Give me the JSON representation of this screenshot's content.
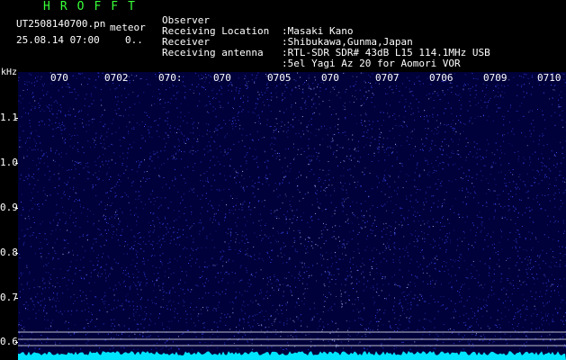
{
  "header": {
    "station_code": "HROFFT",
    "file_name": "UT2508140700.pn",
    "mode": "meteor",
    "date_time": "25.08.14 07:00",
    "count": "0..",
    "info": [
      {
        "label": "Observer",
        "value": ":Masaki Kano"
      },
      {
        "label": "Receiving Location",
        "value": ":Shibukawa,Gunma,Japan"
      },
      {
        "label": "Receiver",
        "value": ":RTL-SDR SDR# 43dB L15 114.1MHz USB"
      },
      {
        "label": "Receiving antenna",
        "value": ":5el Yagi Az 20 for Aomori VOR"
      }
    ]
  },
  "axis": {
    "unit": "kHz",
    "y_ticks": [
      "1.1",
      "1.0",
      "0.9",
      "0.8",
      "0.7",
      "0.6"
    ],
    "time_labels": [
      "070",
      "0702",
      "070:",
      "070",
      "0705",
      "070",
      "0707",
      "0706",
      "0709",
      "0710"
    ]
  },
  "colors": {
    "background": "#000000",
    "waterfall_base": "#00003a",
    "noise_dot": "#3b4dff",
    "bright_dot": "#a9b6ff",
    "signal_trace": "#00e5ff",
    "baseline": "#ffffff",
    "title": "#39ff39"
  }
}
